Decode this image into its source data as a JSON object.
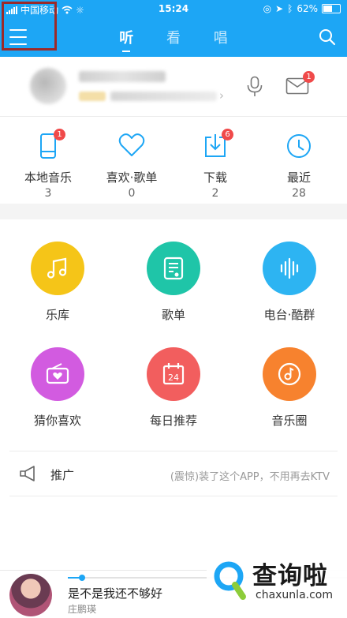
{
  "status_bar": {
    "carrier": "中国移动",
    "time": "15:24",
    "battery": "62%",
    "battery_level": 0.62
  },
  "nav": {
    "tabs": [
      {
        "label": "听",
        "active": true
      },
      {
        "label": "看",
        "active": false
      },
      {
        "label": "唱",
        "active": false
      }
    ],
    "icons": {
      "menu": "menu-icon",
      "search": "search-icon"
    }
  },
  "profile": {
    "mail_badge": "1",
    "icons": {
      "voice": "microphone-icon",
      "mail": "mail-icon"
    }
  },
  "quick_access": [
    {
      "label": "本地音乐",
      "count": "3",
      "badge": "1",
      "icon": "phone-icon"
    },
    {
      "label": "喜欢·歌单",
      "count": "0",
      "badge": "",
      "icon": "heart-icon"
    },
    {
      "label": "下载",
      "count": "2",
      "badge": "6",
      "icon": "download-icon"
    },
    {
      "label": "最近",
      "count": "28",
      "badge": "",
      "icon": "clock-icon"
    }
  ],
  "features": [
    {
      "label": "乐库",
      "color": "#f5c518",
      "icon": "music-note-icon"
    },
    {
      "label": "歌单",
      "color": "#1fc5a8",
      "icon": "playlist-icon"
    },
    {
      "label": "电台·酷群",
      "color": "#2db4f2",
      "icon": "sound-wave-icon"
    },
    {
      "label": "猜你喜欢",
      "color": "#d25be0",
      "icon": "radio-heart-icon"
    },
    {
      "label": "每日推荐",
      "color": "#f25e5e",
      "icon": "calendar-icon"
    },
    {
      "label": "音乐圈",
      "color": "#f7822e",
      "icon": "music-disc-icon"
    }
  ],
  "calendar_day": "24",
  "promo": {
    "title": "推广",
    "text": "(震惊)装了这个APP，不用再去KTV",
    "icon": "megaphone-icon"
  },
  "player": {
    "song": "是不是我还不够好",
    "artist": "庄鹏瑛",
    "progress": 0.05
  },
  "watermark": {
    "cn": "查询啦",
    "en": "chaxunla.com"
  },
  "colors": {
    "accent": "#1da6f5",
    "badge": "#f04a4a"
  }
}
